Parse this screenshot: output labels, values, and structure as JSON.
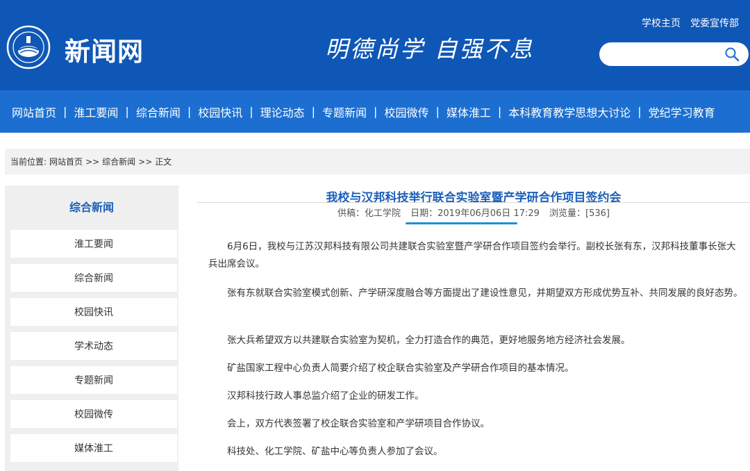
{
  "header": {
    "site_name": "新闻网",
    "motto": "明德尚学 自强不息",
    "top_links": [
      "学校主页",
      "党委宣传部"
    ],
    "search": {
      "placeholder": "",
      "value": ""
    },
    "colors": {
      "header_bg": "#0f57b7",
      "nav_bg": "#1c6fd0",
      "accent": "#1b5fb8"
    }
  },
  "nav": {
    "items": [
      "网站首页",
      "淮工要闻",
      "综合新闻",
      "校园快讯",
      "理论动态",
      "专题新闻",
      "校园微传",
      "媒体淮工",
      "本科教育教学思想大讨论",
      "党纪学习教育"
    ],
    "separator": "|"
  },
  "breadcrumb": {
    "prefix": "当前位置:",
    "items": [
      "网站首页",
      ">>",
      "综合新闻",
      ">>",
      "正文"
    ]
  },
  "sidebar": {
    "title": "综合新闻",
    "items": [
      "淮工要闻",
      "综合新闻",
      "校园快讯",
      "学术动态",
      "专题新闻",
      "校园微传",
      "媒体淮工"
    ]
  },
  "article": {
    "title": "我校与汉邦科技举行联合实验室暨产学研合作项目签约会",
    "source": "供稿：化工学院",
    "date": "日期：2019年06月06日 17:29",
    "views": "浏览量：[536]",
    "paragraphs": [
      "6月6日，我校与江苏汉邦科技有限公司共建联合实验室暨产学研合作项目签约会举行。副校长张有东，汉邦科技董事长张大兵出席会议。",
      "张有东就联合实验室模式创新、产学研深度融合等方面提出了建设性意见，并期望双方形成优势互补、共同发展的良好态势。",
      "张大兵希望双方以共建联合实验室为契机，全力打造合作的典范，更好地服务地方经济社会发展。",
      "矿盐国家工程中心负责人简要介绍了校企联合实验室及产学研合作项目的基本情况。",
      "汉邦科技行政人事总监介绍了企业的研发工作。",
      "会上，双方代表签署了校企联合实验室和产学研项目合作协议。",
      "科技处、化工学院、矿盐中心等负责人参加了会议。"
    ]
  }
}
